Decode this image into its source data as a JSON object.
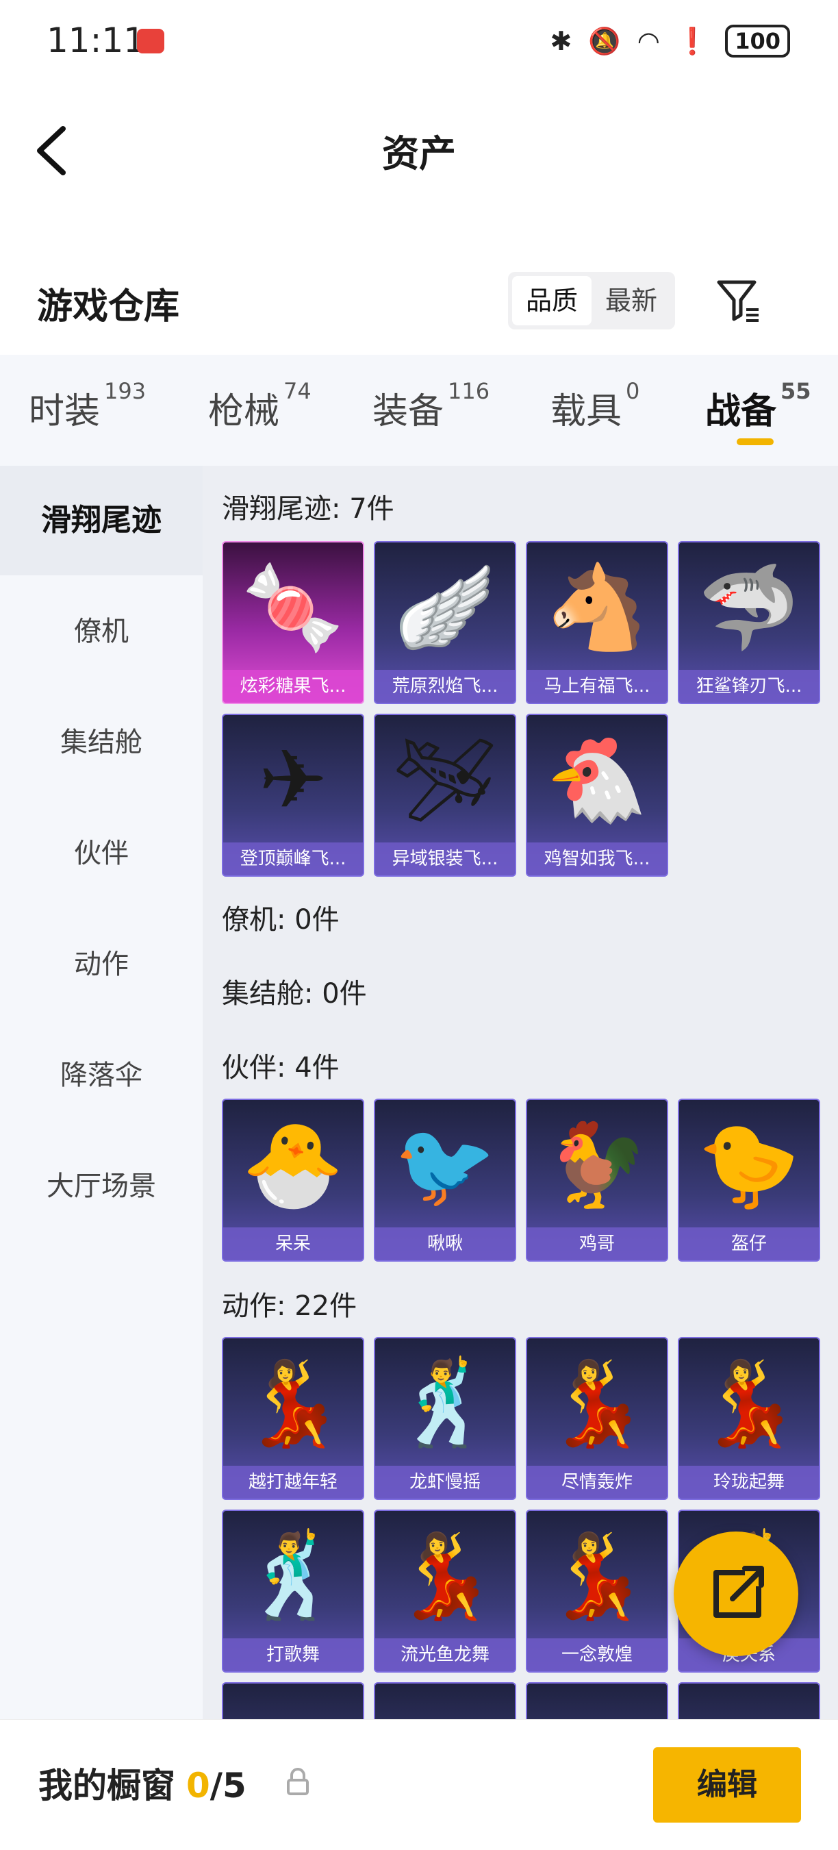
{
  "status_bar": {
    "time": "11:11",
    "battery": "100"
  },
  "header": {
    "title": "资产"
  },
  "section": {
    "title": "游戏仓库",
    "sort_options": [
      "品质",
      "最新"
    ],
    "active_sort": "品质"
  },
  "tabs": [
    {
      "label": "时装",
      "count": "193"
    },
    {
      "label": "枪械",
      "count": "74"
    },
    {
      "label": "装备",
      "count": "116"
    },
    {
      "label": "载具",
      "count": "0"
    },
    {
      "label": "战备",
      "count": "55",
      "active": true
    }
  ],
  "sidenav": [
    {
      "label": "滑翔尾迹",
      "active": true
    },
    {
      "label": "僚机"
    },
    {
      "label": "集结舱"
    },
    {
      "label": "伙伴"
    },
    {
      "label": "动作"
    },
    {
      "label": "降落伞"
    },
    {
      "label": "大厅场景"
    }
  ],
  "categories": {
    "glide": {
      "heading": "滑翔尾迹: 7件",
      "items": [
        "炫彩糖果飞...",
        "荒原烈焰飞...",
        "马上有福飞...",
        "狂鲨锋刃飞...",
        "登顶巅峰飞...",
        "异域银装飞...",
        "鸡智如我飞..."
      ],
      "icons": [
        "candy-glider-icon",
        "flame-glider-icon",
        "horse-glider-icon",
        "shark-glider-icon",
        "summit-glider-icon",
        "silver-glider-icon",
        "chicken-glider-icon"
      ]
    },
    "wingman": {
      "heading": "僚机: 0件"
    },
    "pod": {
      "heading": "集结舱: 0件"
    },
    "partner": {
      "heading": "伙伴: 4件",
      "items": [
        "呆呆",
        "啾啾",
        "鸡哥",
        "盔仔"
      ],
      "icons": [
        "chick-icon",
        "pink-bird-icon",
        "rooster-icon",
        "helmet-chick-icon"
      ]
    },
    "emote": {
      "heading": "动作: 22件",
      "items": [
        "越打越年轻",
        "龙虾慢摇",
        "尽情轰炸",
        "玲珑起舞",
        "打歌舞",
        "流光鱼龙舞",
        "一念敦煌",
        "庚矢系"
      ],
      "icons": [
        "dancer-icon",
        "dancer-icon",
        "dancer-icon",
        "dancer-icon",
        "dancer-icon",
        "dancer-icon",
        "dancer-icon",
        "dancer-icon"
      ]
    }
  },
  "bottom": {
    "label": "我的橱窗",
    "count": "0",
    "total": "/5",
    "edit": "编辑"
  },
  "colors": {
    "accent": "#f6b500",
    "card_purple": "#3a3b78",
    "card_pink": "#9a2aa4"
  }
}
